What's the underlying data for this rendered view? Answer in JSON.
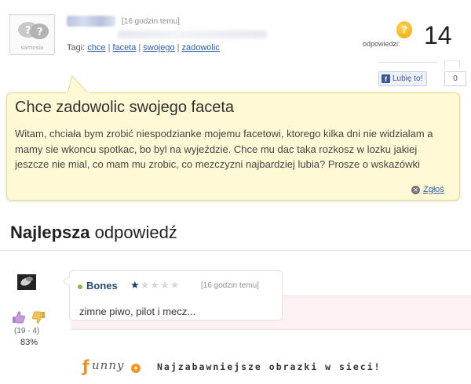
{
  "question": {
    "posted_time": "[16 godzin temu]",
    "tags_label": "Tagi:",
    "tags": [
      "chce",
      "faceta",
      "swojego",
      "zadowolic"
    ],
    "answers_label": "odpowiedzi:",
    "answers_count": "14",
    "title": "Chce zadowolic swojego faceta",
    "body": "Witam, chciała bym zrobić niespodzianke mojemu facetowi, ktorego kilka dni nie widzialam a mamy sie wkoncu spotkac, bo byl na wyjeździe. Chce mu dac taka rozkosz w lozku jakiej jeszcze nie mial, co mam mu zrobic, co mezczyzni najbardziej lubia? Prosze o wskazówki",
    "report_label": "Zgłoś",
    "avatar_logo_text": "samosia"
  },
  "facebook": {
    "like_label": "Lubię to!",
    "like_count": "0",
    "icon": "facebook-f-icon"
  },
  "best_answer": {
    "heading_bold": "Najlepsza",
    "heading_rest": " odpowiedź",
    "user": "Bones",
    "stars": "★★★★★",
    "rating_stars_filled": 0.5,
    "time": "[16 godzin temu]",
    "text": "zimne piwo, pilot i mecz...",
    "votes": "(19 - 4)",
    "percent": "83%"
  },
  "footer": {
    "logo_text": "unny",
    "tagline": "Najzabawniejsze obrazki w sieci!"
  },
  "colors": {
    "question_bg": "#fff9d6",
    "question_border": "#e7d98a",
    "link": "#2a5ea8",
    "brand_orange": "#f29a1f",
    "facebook_blue": "#3b5998"
  }
}
